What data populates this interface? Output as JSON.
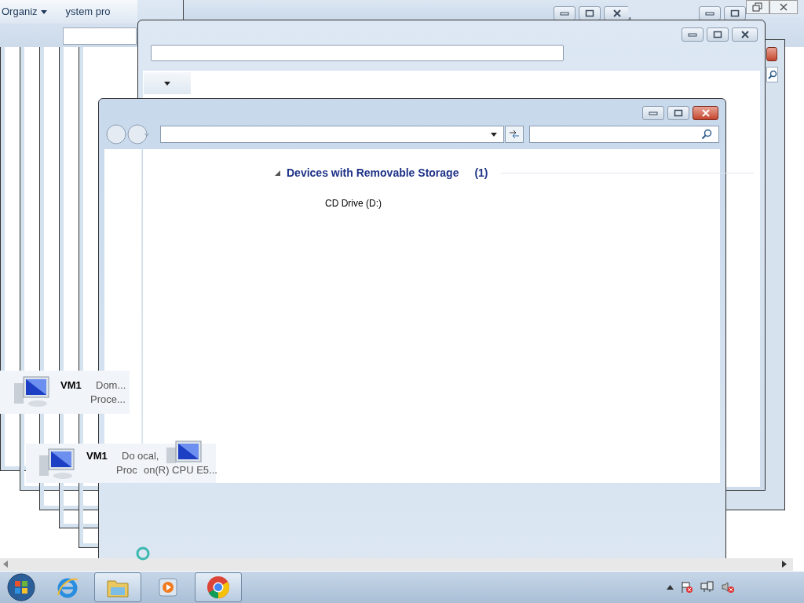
{
  "back_window": {
    "toolbar": [
      {
        "label": "Organiz",
        "dropdown": true
      },
      {
        "label": "ystem pro",
        "dropdown": false
      }
    ]
  },
  "main_window": {
    "groups": [
      {
        "title": "Devices with Removable Storage",
        "count": "(1)",
        "expanded": true,
        "items": [
          "CD Drive (D:)"
        ]
      }
    ]
  },
  "ghost_items": [
    {
      "name": "VM1",
      "lines": [
        {
          "left": "Dom..."
        },
        {
          "left": "Proce..."
        }
      ]
    },
    {
      "name": "VM1",
      "lines": [
        {
          "left": "Do",
          "right": "ocal,"
        },
        {
          "left": "Proc",
          "right": "on(R) CPU E5..."
        }
      ]
    }
  ],
  "taskbar": {
    "apps": [
      {
        "kind": "ie",
        "selected": false
      },
      {
        "kind": "explorer",
        "selected": true
      },
      {
        "kind": "media",
        "selected": false
      },
      {
        "kind": "chrome",
        "selected": true
      }
    ]
  }
}
